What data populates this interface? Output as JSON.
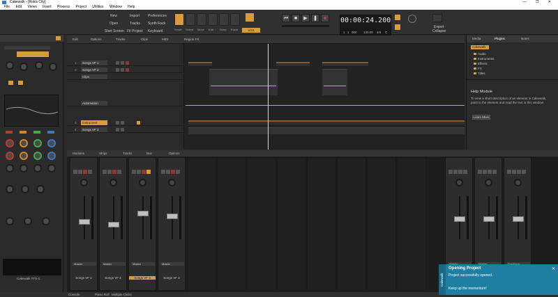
{
  "window": {
    "title": "Cakewalk - [Rokis City]",
    "controls": "— ❐ ✕"
  },
  "menu": [
    "File",
    "Edit",
    "Views",
    "Insert",
    "Process",
    "Project",
    "Utilities",
    "Window",
    "Help"
  ],
  "controlbar": {
    "buttons": [
      "New",
      "Import",
      "Preferences",
      "Open",
      "Tracks",
      "Synth Rack",
      "Start Screen",
      "Fit Project",
      "Keyboard"
    ],
    "tool_labels": [
      "Smart",
      "Select",
      "Move",
      "Edit",
      "Draw",
      "Erase"
    ],
    "snap_value": "1/16",
    "time": "00:00:24.200",
    "time_sub": [
      "1",
      "1",
      "000",
      "130.00",
      "4/4",
      "C"
    ],
    "right_labels": [
      "Export",
      "Collapse"
    ]
  },
  "inspector": {
    "bottom_label": "Cakewalk TTS-1"
  },
  "trackview": {
    "menus": [
      "Edit",
      "Options",
      "Tracks",
      "Clips",
      "MIDI",
      "Region FX"
    ],
    "tracks": [
      {
        "num": "1",
        "name": "Songs VF 1"
      },
      {
        "num": "2",
        "name": "Songs VF 2"
      },
      {
        "num": "",
        "name": "Clips"
      },
      {
        "num": "",
        "name": "Automation"
      },
      {
        "num": "3",
        "name": "Instrument"
      },
      {
        "num": "4",
        "name": "Songs VF 3"
      }
    ]
  },
  "browser": {
    "tabs": [
      "Media",
      "Plugins",
      "Notes"
    ],
    "search_value": "Cakewalk",
    "folders": [
      "Audio",
      "Instruments",
      "Effects",
      "FX",
      "Titles"
    ],
    "help_title": "Help Module",
    "help_text": "To view a short description of an element in Cakewalk, point to the element and read the text in this window.",
    "help_button": "Learn More"
  },
  "console": {
    "tabs": [
      "Modules",
      "Strips",
      "Tracks",
      "Bus",
      "Options"
    ],
    "strips": [
      {
        "name": "Songs VF 1",
        "out": "Master"
      },
      {
        "name": "Songs VF 2",
        "out": "Master"
      },
      {
        "name": "Songs VF 3",
        "out": "Master"
      },
      {
        "name": "Songs VF 4",
        "out": "Master"
      },
      {
        "name": "Preview",
        "out": "Master"
      },
      {
        "name": "Metronome",
        "out": "Master"
      },
      {
        "name": "Master",
        "out": "Speakers"
      }
    ]
  },
  "statusbar": [
    "Console",
    "Piano Roll",
    "Multiple Clicks"
  ],
  "toast": {
    "brand": "Cakewalk",
    "title": "Opening Project",
    "message": "Project successfully opened.",
    "sub": "Keep up the momentum!"
  }
}
